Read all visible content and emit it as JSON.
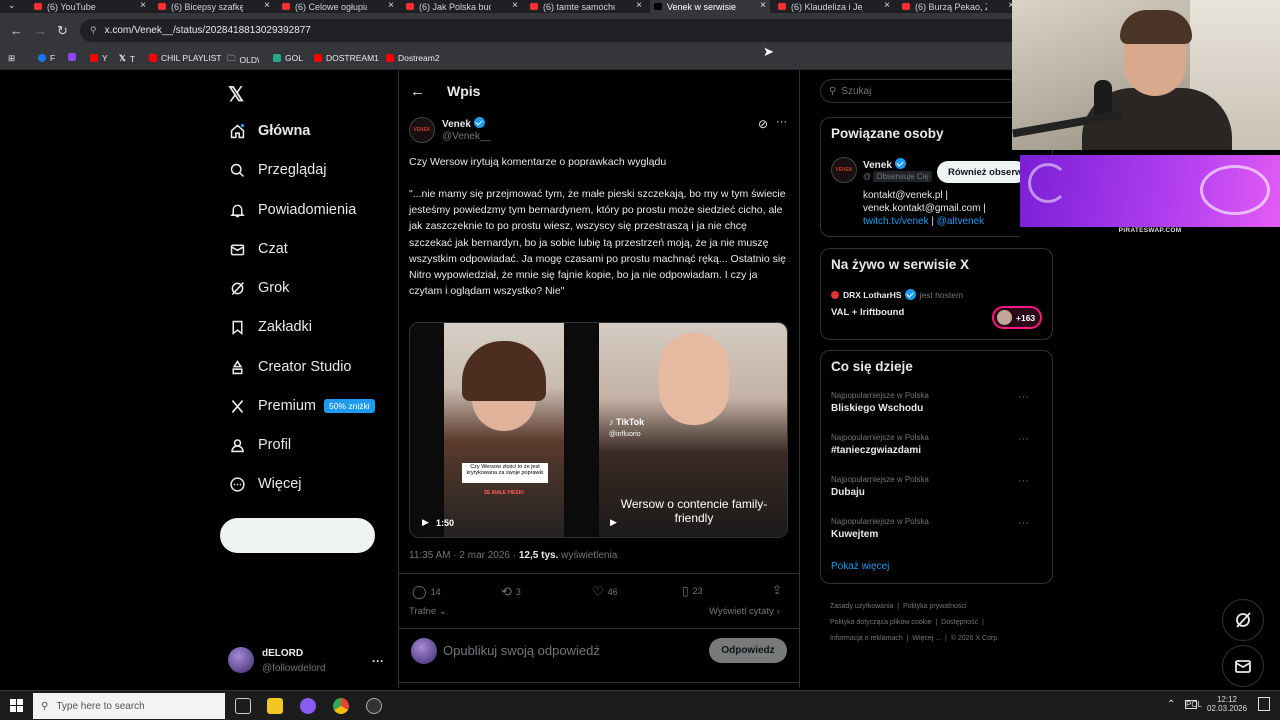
{
  "browser": {
    "tabs": [
      {
        "label": "(6) YouTube",
        "active": false
      },
      {
        "label": "(6) Bicepsy szafkę w k",
        "active": false
      },
      {
        "label": "(6) Celowe ogłupianie",
        "active": false
      },
      {
        "label": "(6) Jak Polska buduje",
        "active": false
      },
      {
        "label": "(6) tamte samochody",
        "active": false
      },
      {
        "label": "Venek w serwisie X: „",
        "active": true
      },
      {
        "label": "(6) Klaudeliza i Jej Ch",
        "active": false
      },
      {
        "label": "(6) Burzą Pekao, Z",
        "active": false
      }
    ],
    "url": "x.com/Venek__/status/2028418813029392877",
    "bookmarks": [
      "F",
      "Y",
      "T",
      "CHIL PLAYLIST",
      "OLD\\",
      "GOL",
      "DOSTREAM1",
      "Dostream2"
    ]
  },
  "nav": {
    "items": [
      {
        "label": "Główna",
        "icon": "home-icon"
      },
      {
        "label": "Przeglądaj",
        "icon": "search-icon"
      },
      {
        "label": "Powiadomienia",
        "icon": "bell-icon"
      },
      {
        "label": "Czat",
        "icon": "mail-icon"
      },
      {
        "label": "Grok",
        "icon": "grok-icon"
      },
      {
        "label": "Zakładki",
        "icon": "bookmark-icon"
      },
      {
        "label": "Creator Studio",
        "icon": "creator-icon"
      },
      {
        "label": "Premium",
        "icon": "x-logo-icon"
      },
      {
        "label": "Profil",
        "icon": "person-icon"
      },
      {
        "label": "Więcej",
        "icon": "more-circle-icon"
      }
    ],
    "premium_badge": "50% zniżki",
    "account": {
      "name": "dELORD",
      "handle": "@followdelord"
    }
  },
  "header": {
    "title": "Wpis"
  },
  "post": {
    "author_name": "Venek",
    "author_handle": "@Venek__",
    "avatar_text": "VENEK",
    "title_line": "Czy Wersow irytują komentarze o poprawkach wyglądu",
    "body": "\"...nie mamy się przejmować tym, że małe pieski szczekają, bo my w tym świecie jesteśmy powiedzmy tym bernardynem, który po prostu może siedzieć cicho, ale jak zaszczeknie to po prostu wiesz, wszyscy się przestraszą i ja nie chcę szczekać jak bernardyn, bo ja sobie lubię tą przestrzeń moją, że ja nie muszę wszystkim odpowiadać. Ja mogę czasami po prostu machnąć ręką... Ostatnio się Nitro wypowiedział, że mnie się fajnie kopie, bo ja nie odpowiadam. I czy ja czytam i oglądam wszystko? Nie\"",
    "video1": {
      "duration": "1:50",
      "caption": "Czy Wersow złości to że jest krytykowana za swoje poprawki",
      "brand": "ŻE MAŁE PIESKI"
    },
    "video2": {
      "tiktok": "TikTok",
      "handle": "@influorio",
      "caption": "Wersow o contencie family-friendly"
    },
    "time": "11:35 AM · 2 mar 2026 · ",
    "views": "12,5 tys.",
    "views_label": " wyświetlenia",
    "stats": {
      "replies": "14",
      "reposts": "3",
      "likes": "46",
      "bookmarks": "23"
    },
    "sort_label": "Trafne",
    "show_quotes": "Wyświetl cytaty",
    "reply_placeholder": "Opublikuj swoją odpowiedź",
    "reply_button": "Odpowiedz"
  },
  "sidebar": {
    "search_placeholder": "Szukaj",
    "related": {
      "title": "Powiązane osoby",
      "name": "Venek",
      "handle": "@",
      "follows_you": "Obserwuje Cię",
      "follow_button": "Również obserw",
      "bio1": "kontakt@venek.pl |",
      "bio2": "venek.kontakt@gmail.com |",
      "bio3_link": "twitch.tv/venek",
      "bio3_sep": " | ",
      "bio3_link2": "@altvenek"
    },
    "live": {
      "title": "Na żywo w serwisie X",
      "host": "DRX LotharHS",
      "host_suffix": "jest hostem",
      "space_title": "VAL + Iriftbound",
      "listeners": "+163"
    },
    "trends": {
      "title": "Co się dzieje",
      "items": [
        {
          "context": "Najpopularniejsze w Polska",
          "name": "Bliskiego Wschodu"
        },
        {
          "context": "Najpopularniejsze w Polska",
          "name": "#tanieczgwiazdami"
        },
        {
          "context": "Najpopularniejsze w Polska",
          "name": "Dubaju"
        },
        {
          "context": "Najpopularniejsze w Polska",
          "name": "Kuwejtem"
        }
      ],
      "show_more": "Pokaż więcej"
    },
    "footer": {
      "line1": [
        "Zasady użytkowania",
        "Polityka prywatności"
      ],
      "line2": [
        "Polityka dotycząca plików cookie",
        "Dostępność"
      ],
      "line3": [
        "Informacja o reklamach",
        "Więcej ...",
        "© 2026 X Corp."
      ]
    }
  },
  "overlay": {
    "ad_caption": "PIRATESWAP.COM"
  },
  "taskbar": {
    "search_placeholder": "Type here to search",
    "lang": "POL",
    "time": "12:12",
    "date": "02.03.2026"
  },
  "colors": {
    "accent": "#1d9bf0",
    "background": "#000000",
    "muted": "#71767b",
    "like": "#f91880"
  }
}
